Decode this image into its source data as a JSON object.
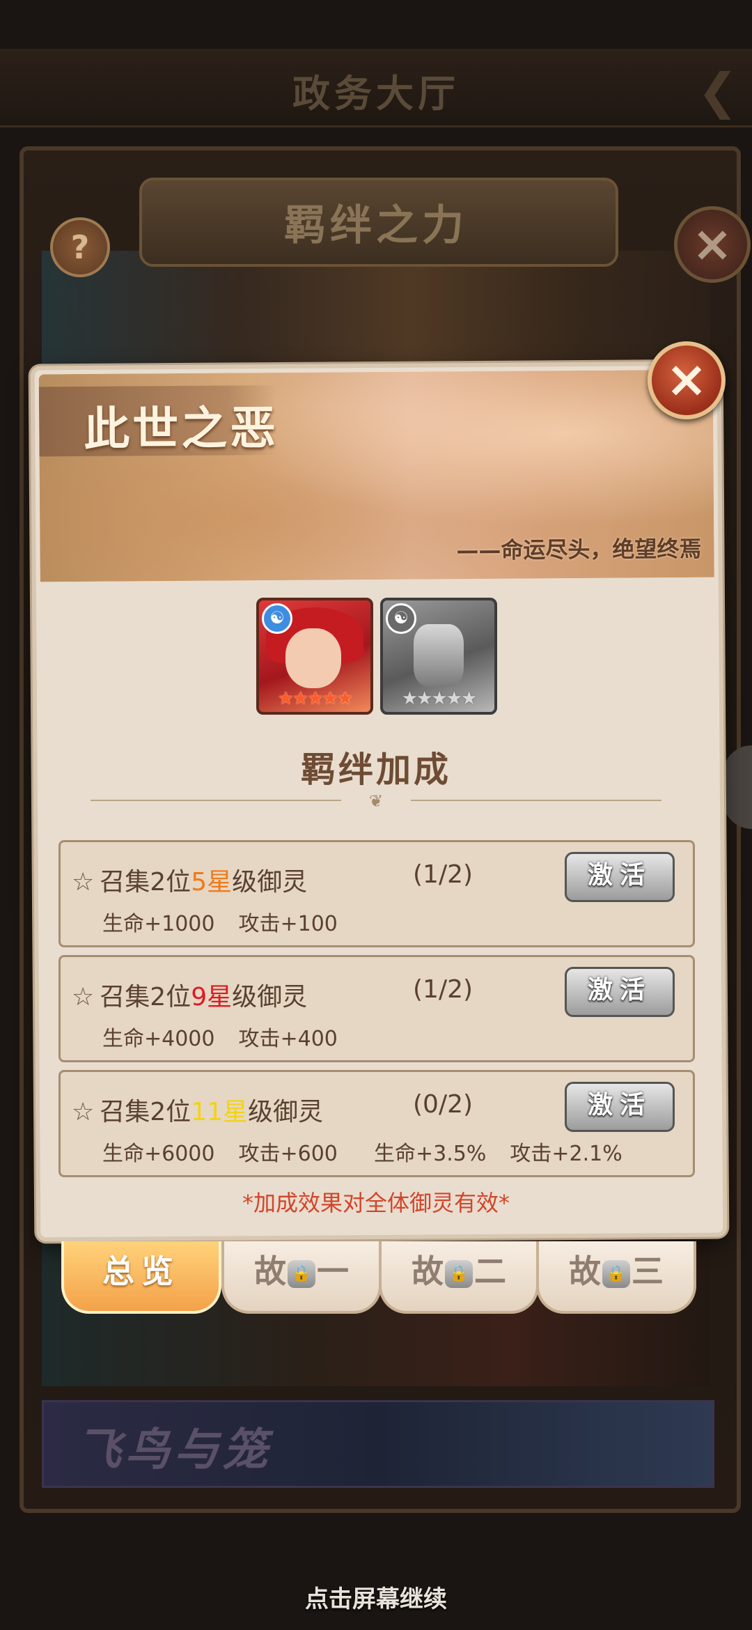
{
  "background": {
    "hall_title": "政务大厅",
    "banner_title": "羁绊之力",
    "help_label": "?",
    "close_label": "×",
    "lower_card_title": "飞鸟与笼"
  },
  "dialog": {
    "title": "此世之恶",
    "subtitle": "——命运尽头，绝望终焉",
    "close_label": "×",
    "heroes": [
      {
        "name": "red-haired-hero",
        "stars": "★★★★★",
        "element": "☯"
      },
      {
        "name": "armored-hero",
        "stars": "★★★★★",
        "element": "☯"
      }
    ],
    "section_title": "羁绊加成",
    "bonus_rows": [
      {
        "prefix": "召集2位",
        "star_level": "5星",
        "suffix": "级御灵",
        "progress": "(1/2)",
        "hp": "生命+1000",
        "atk": "攻击+100",
        "button": "激活"
      },
      {
        "prefix": "召集2位",
        "star_level": "9星",
        "suffix": "级御灵",
        "progress": "(1/2)",
        "hp": "生命+4000",
        "atk": "攻击+400",
        "button": "激活"
      },
      {
        "prefix": "召集2位",
        "star_level": "11星",
        "suffix": "级御灵",
        "progress": "(0/2)",
        "hp": "生命+6000",
        "atk": "攻击+600",
        "hp_pct": "生命+3.5%",
        "atk_pct": "攻击+2.1%",
        "button": "激活"
      }
    ],
    "note": "*加成效果对全体御灵有效*"
  },
  "tabs": [
    {
      "label": "总览",
      "active": true
    },
    {
      "pre": "故",
      "post": "一",
      "locked": true
    },
    {
      "pre": "故",
      "post": "二",
      "locked": true
    },
    {
      "pre": "故",
      "post": "三",
      "locked": true
    }
  ],
  "footer": {
    "continue": "点击屏幕继续"
  },
  "colors": {
    "star_5": "#f07a1a",
    "star_9": "#e01822",
    "star_11": "#f2d21a",
    "note": "#d2452a",
    "active_tab": "#f3a24a"
  }
}
